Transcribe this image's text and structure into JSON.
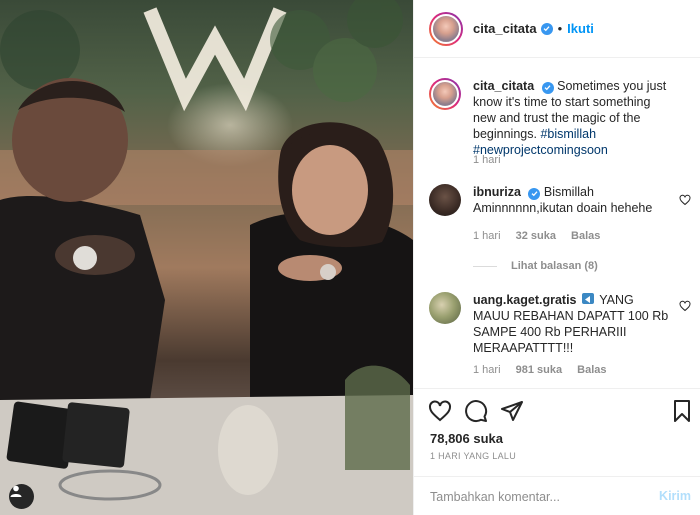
{
  "post": {
    "username": "cita_citata",
    "follow_label": "Ikuti",
    "dot": "•"
  },
  "caption": {
    "username": "cita_citata",
    "text": "Sometimes you just know it's time to start something new and trust the magic of the beginnings.",
    "hashtags": "#bismillah #newprojectcomingsoon",
    "time": "1 hari"
  },
  "comments": [
    {
      "username": "ibnuriza",
      "verified": true,
      "text_line1": "Bismillah",
      "text_line2": "Aminnnnnn,ikutan doain hehehe",
      "time": "1 hari",
      "likes": "32 suka",
      "reply": "Balas",
      "view_replies": "Lihat balasan (8)"
    },
    {
      "username": "uang.kaget.gratis",
      "verified": false,
      "text": "YANG MAUU REBAHAN DAPATT 100 Rb SAMPE 400 Rb PERHARIII MERAAPATTTT!!!",
      "time": "1 hari",
      "likes": "981 suka",
      "reply": "Balas"
    }
  ],
  "actions": {
    "likes_count": "78,806 suka",
    "time_ago": "1 HARI YANG LALU"
  },
  "comment_box": {
    "placeholder": "Tambahkan komentar...",
    "post_label": "Kirim"
  },
  "icons": {
    "verified": "verified-check-icon",
    "like": "heart-icon",
    "comment": "comment-bubble-icon",
    "share": "paper-plane-icon",
    "save": "bookmark-icon",
    "tag": "user-tag-icon"
  },
  "colors": {
    "accent": "#0095f6",
    "verified": "#3897f0",
    "link": "#00376b",
    "muted": "#8e8e8e"
  }
}
